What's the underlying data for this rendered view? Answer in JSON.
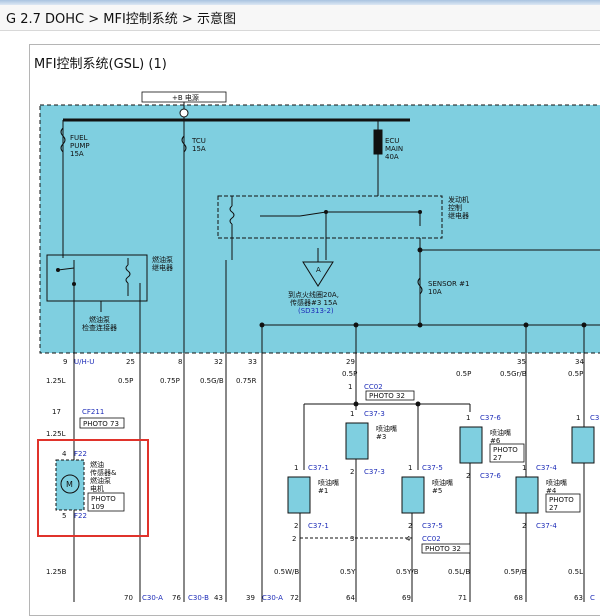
{
  "breadcrumb": "G 2.7 DOHC > MFI控制系统 > 示意图",
  "diagram_title": "MFI控制系统(GSL) (1)",
  "colors": {
    "panel": "#7fcfe0",
    "part": "#7fcfe0",
    "link": "#1e2db8",
    "highlight": "#e0332b",
    "wire": "#111111"
  },
  "power_label": "+B 电源",
  "fuses": {
    "fuel_pump": [
      "FUEL",
      "PUMP",
      "15A"
    ],
    "tcu": [
      "TCU",
      "15A"
    ],
    "ecu_main": [
      "ECU",
      "MAIN",
      "40A"
    ],
    "sensor": [
      "SENSOR #1",
      "10A"
    ]
  },
  "relays": {
    "engine": [
      "发动机",
      "控制",
      "继电器"
    ],
    "fuel_pump": [
      "燃油泵",
      "继电器"
    ]
  },
  "notes": {
    "ign_line1": "到点火线圈20A,",
    "ign_line2": "传感器#3 15A",
    "ign_ref": "(SD313-2)",
    "fp_check_1": "燃油泵",
    "fp_check_2": "检查连接器"
  },
  "pins": [
    "9",
    "25",
    "8",
    "32",
    "33",
    "29",
    "35",
    "34"
  ],
  "wire_top": {
    "u_h_u": "U/H-U",
    "p1": "1.25L",
    "p2": "0.5P",
    "p3": "0.75P",
    "p4": "0.5G/B",
    "p5": "0.75R",
    "p6": "0.5P",
    "p7": "0.5P",
    "p8": "0.5Gr/B",
    "p9": "0.5P"
  },
  "connectors": {
    "cf211": "CF211",
    "photo73": "PHOTO 73",
    "cc02": "CC02",
    "photo32": "PHOTO 32",
    "c37_1": "C37-1",
    "c37_2": "C37-2",
    "c37_3": "C37-3",
    "c37_4": "C37-4",
    "c37_5": "C37-5",
    "c37_6": "C37-6",
    "c3": "C3",
    "f22": "F22"
  },
  "pin_small": {
    "p17": "17",
    "p1": "1",
    "p2": "2",
    "p3": "3",
    "p4": "4",
    "p5": "5"
  },
  "injectors": {
    "name": "喷油嘴",
    "n1": "#1",
    "n3": "#3",
    "n4": "#4",
    "n5": "#5",
    "n6": "#6",
    "photo27": "PHOTO",
    "photo27b": "27"
  },
  "fuel_pump_module": {
    "l1": "燃油",
    "l2": "传感器&",
    "l3": "燃油泵",
    "l4": "电机",
    "photo": "PHOTO",
    "photo_no": "109",
    "m": "M"
  },
  "wire_bottom": {
    "b1": "1.25L",
    "b2": "1.25B",
    "b3": "0.5W/B",
    "b4": "0.5Y",
    "b5": "0.5Y/B",
    "b6": "0.5L/B",
    "b7": "0.5P/B",
    "b8": "0.5L"
  },
  "bottom_refs": [
    "70",
    "C30-A",
    "76",
    "C30-B",
    "43",
    "39",
    "C30-A",
    "72",
    "64",
    "69",
    "71",
    "68",
    "63",
    "C"
  ],
  "injector_terms": {
    "t1": "1",
    "t2": "2"
  }
}
